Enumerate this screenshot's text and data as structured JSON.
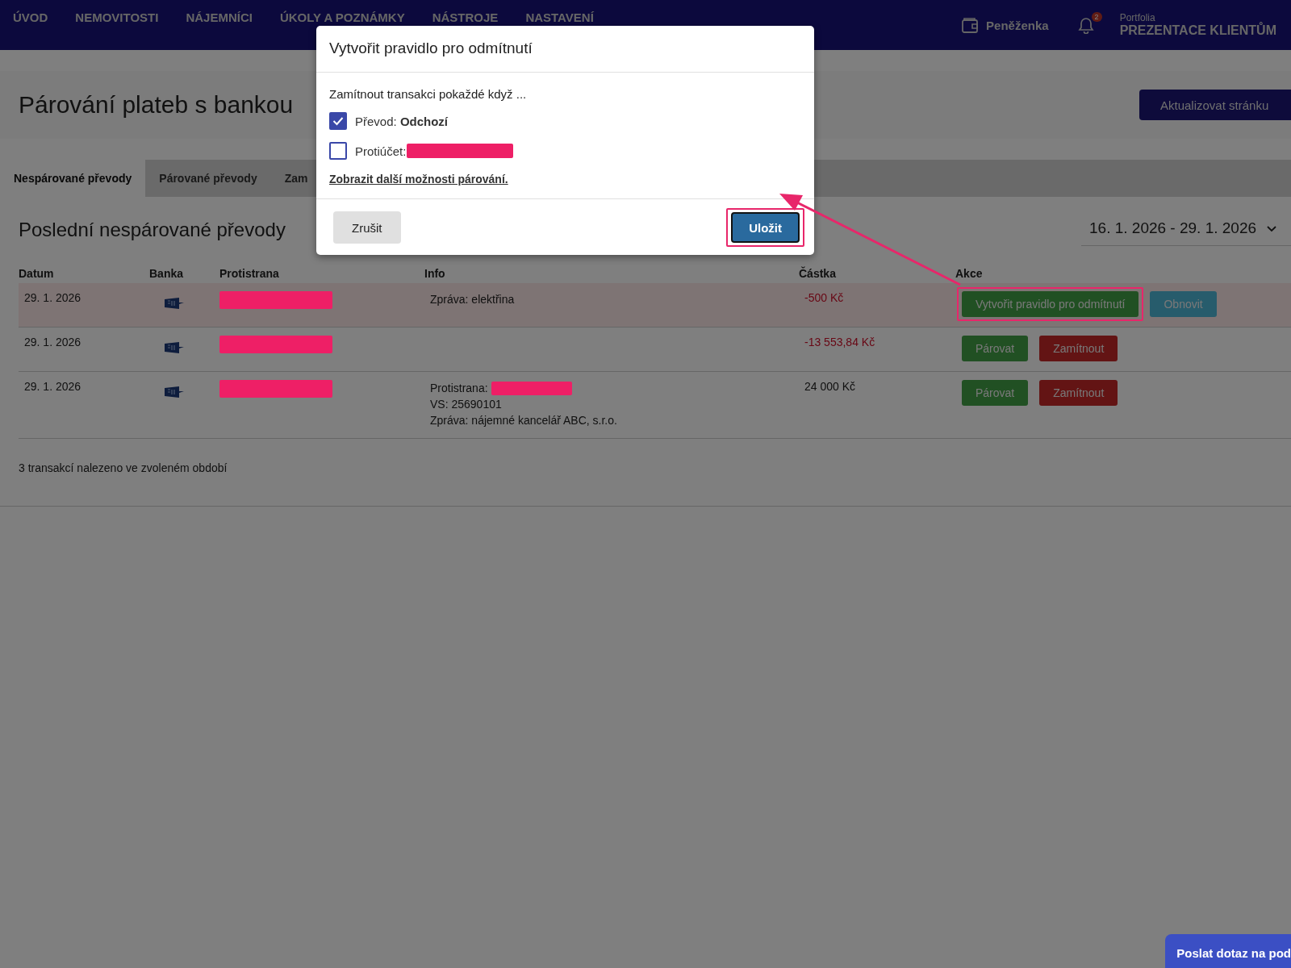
{
  "nav": {
    "items": [
      {
        "label": "ÚVOD"
      },
      {
        "label": "NEMOVITOSTI"
      },
      {
        "label": "NÁJEMNÍCI"
      },
      {
        "label": "ÚKOLY A POZNÁMKY"
      },
      {
        "label": "NÁSTROJE"
      },
      {
        "label": "NASTAVENÍ"
      }
    ],
    "wallet": "Peněženka",
    "notification_count": "2",
    "account_caption": "Portfolia",
    "account_name": "PREZENTACE KLIENTŮM"
  },
  "page": {
    "title": "Párování plateb s bankou",
    "refresh_button": "Aktualizovat stránku"
  },
  "tabs": [
    {
      "label": "Nespárované převody",
      "selected": true
    },
    {
      "label": "Párované převody",
      "selected": false
    },
    {
      "label": "Zam",
      "selected": false
    }
  ],
  "section": {
    "title": "Poslední nespárované převody",
    "date_range": "16. 1. 2026 - 29. 1. 2026"
  },
  "table": {
    "columns": [
      "Datum",
      "Banka",
      "Protistrana",
      "Info",
      "Částka",
      "Akce"
    ],
    "rows": [
      {
        "date": "29. 1. 2026",
        "highlighted": true,
        "counterparty_redacted": true,
        "info": [
          {
            "text": "Zpráva: elektřina",
            "redacted": false
          }
        ],
        "amount": "-500 Kč",
        "negative": true,
        "actions": [
          {
            "kind": "rule",
            "label": "Vytvořit pravidlo pro odmítnutí",
            "annotated": true
          },
          {
            "kind": "restore",
            "label": "Obnovit",
            "annotated": false
          }
        ]
      },
      {
        "date": "29. 1. 2026",
        "highlighted": false,
        "counterparty_redacted": true,
        "info": [],
        "amount": "-13 553,84 Kč",
        "negative": true,
        "actions": [
          {
            "kind": "pair",
            "label": "Párovat",
            "annotated": false
          },
          {
            "kind": "reject",
            "label": "Zamítnout",
            "annotated": false
          }
        ]
      },
      {
        "date": "29. 1. 2026",
        "highlighted": false,
        "counterparty_redacted": true,
        "info": [
          {
            "text": "Protistrana:",
            "redacted": true
          },
          {
            "text": "VS: 25690101",
            "redacted": false
          },
          {
            "text": "Zpráva: nájemné kancelář ABC, s.r.o.",
            "redacted": false
          }
        ],
        "amount": "24 000 Kč",
        "negative": false,
        "actions": [
          {
            "kind": "pair",
            "label": "Párovat",
            "annotated": false
          },
          {
            "kind": "reject",
            "label": "Zamítnout",
            "annotated": false
          }
        ]
      }
    ]
  },
  "summary": "3 transakcí nalezeno ve zvoleném období",
  "modal": {
    "title": "Vytvořit pravidlo pro odmítnutí",
    "prompt": "Zamítnout transakci pokaždé když ...",
    "conditions": [
      {
        "label": "Převod: **Odchozí**",
        "redacted": false,
        "checked": true
      },
      {
        "label": "Protiúčet:",
        "redacted": true,
        "checked": false
      }
    ],
    "more_link": "Zobrazit další možnosti párování.",
    "cancel": "Zrušit",
    "save": "Uložit",
    "save_annotated": true
  },
  "chat_button": "Poslat dotaz na pod"
}
